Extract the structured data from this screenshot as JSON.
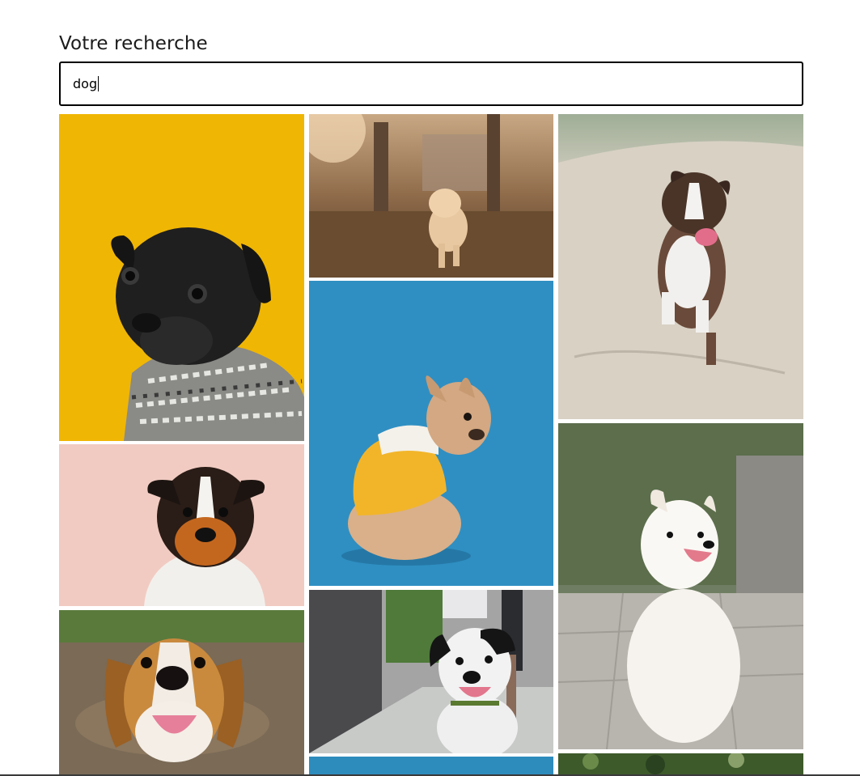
{
  "search": {
    "label": "Votre recherche",
    "value": "dog"
  },
  "gallery": {
    "photos": [
      {
        "subject": "black pug in knit sweater",
        "background": "#f0b604"
      },
      {
        "subject": "golden puppy running in park",
        "background": "#8a6a4a"
      },
      {
        "subject": "australian shepherd running on sand",
        "background": "#d8d2c8"
      },
      {
        "subject": "tricolor terrier on pink",
        "background": "#f1cbc2"
      },
      {
        "subject": "french bulldog in yellow hoodie",
        "background": "#2f8fc2"
      },
      {
        "subject": "white samoyed outdoors",
        "background": "#8e9b86"
      },
      {
        "subject": "beagle smiling outdoors",
        "background": "#7a6a56"
      },
      {
        "subject": "black and white dog on sidewalk",
        "background": "#a4a4a4"
      },
      {
        "subject": "partial photo blue",
        "background": "#2e8cbd"
      },
      {
        "subject": "partial photo green foliage",
        "background": "#3d5a2a"
      }
    ]
  }
}
